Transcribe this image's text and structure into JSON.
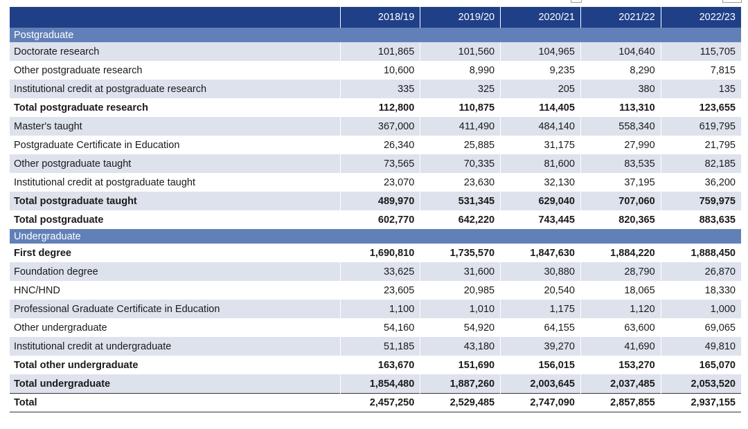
{
  "columns": [
    "",
    "2018/19",
    "2019/20",
    "2020/21",
    "2021/22",
    "2022/23"
  ],
  "sections": [
    {
      "title": "Postgraduate",
      "rows": [
        {
          "label": "Doctorate research",
          "values": [
            "101,865",
            "101,560",
            "104,965",
            "104,640",
            "115,705"
          ],
          "bold": false,
          "shade": true
        },
        {
          "label": "Other postgraduate research",
          "values": [
            "10,600",
            "8,990",
            "9,235",
            "8,290",
            "7,815"
          ],
          "bold": false,
          "shade": false
        },
        {
          "label": "Institutional credit at postgraduate research",
          "values": [
            "335",
            "325",
            "205",
            "380",
            "135"
          ],
          "bold": false,
          "shade": true
        },
        {
          "label": "Total postgraduate research",
          "values": [
            "112,800",
            "110,875",
            "114,405",
            "113,310",
            "123,655"
          ],
          "bold": true,
          "shade": false
        },
        {
          "label": "Master's taught",
          "values": [
            "367,000",
            "411,490",
            "484,140",
            "558,340",
            "619,795"
          ],
          "bold": false,
          "shade": true
        },
        {
          "label": "Postgraduate Certificate in Education",
          "values": [
            "26,340",
            "25,885",
            "31,175",
            "27,990",
            "21,795"
          ],
          "bold": false,
          "shade": false
        },
        {
          "label": "Other postgraduate taught",
          "values": [
            "73,565",
            "70,335",
            "81,600",
            "83,535",
            "82,185"
          ],
          "bold": false,
          "shade": true
        },
        {
          "label": "Institutional credit at postgraduate taught",
          "values": [
            "23,070",
            "23,630",
            "32,130",
            "37,195",
            "36,200"
          ],
          "bold": false,
          "shade": false
        },
        {
          "label": "Total postgraduate taught",
          "values": [
            "489,970",
            "531,345",
            "629,040",
            "707,060",
            "759,975"
          ],
          "bold": true,
          "shade": true
        },
        {
          "label": "Total postgraduate",
          "values": [
            "602,770",
            "642,220",
            "743,445",
            "820,365",
            "883,635"
          ],
          "bold": true,
          "shade": false
        }
      ]
    },
    {
      "title": "Undergraduate",
      "rows": [
        {
          "label": "First degree",
          "values": [
            "1,690,810",
            "1,735,570",
            "1,847,630",
            "1,884,220",
            "1,888,450"
          ],
          "bold": true,
          "shade": false
        },
        {
          "label": "Foundation degree",
          "values": [
            "33,625",
            "31,600",
            "30,880",
            "28,790",
            "26,870"
          ],
          "bold": false,
          "shade": true
        },
        {
          "label": "HNC/HND",
          "values": [
            "23,605",
            "20,985",
            "20,540",
            "18,065",
            "18,330"
          ],
          "bold": false,
          "shade": false
        },
        {
          "label": "Professional Graduate Certificate in Education",
          "values": [
            "1,100",
            "1,010",
            "1,175",
            "1,120",
            "1,000"
          ],
          "bold": false,
          "shade": true
        },
        {
          "label": "Other undergraduate",
          "values": [
            "54,160",
            "54,920",
            "64,155",
            "63,600",
            "69,065"
          ],
          "bold": false,
          "shade": false
        },
        {
          "label": "Institutional credit at undergraduate",
          "values": [
            "51,185",
            "43,180",
            "39,270",
            "41,690",
            "49,810"
          ],
          "bold": false,
          "shade": true
        },
        {
          "label": "Total other undergraduate",
          "values": [
            "163,670",
            "151,690",
            "156,015",
            "153,270",
            "165,070"
          ],
          "bold": true,
          "shade": false
        },
        {
          "label": "Total undergraduate",
          "values": [
            "1,854,480",
            "1,887,260",
            "2,003,645",
            "2,037,485",
            "2,053,520"
          ],
          "bold": true,
          "shade": true
        }
      ]
    }
  ],
  "total": {
    "label": "Total",
    "values": [
      "2,457,250",
      "2,529,485",
      "2,747,090",
      "2,857,855",
      "2,937,155"
    ]
  }
}
